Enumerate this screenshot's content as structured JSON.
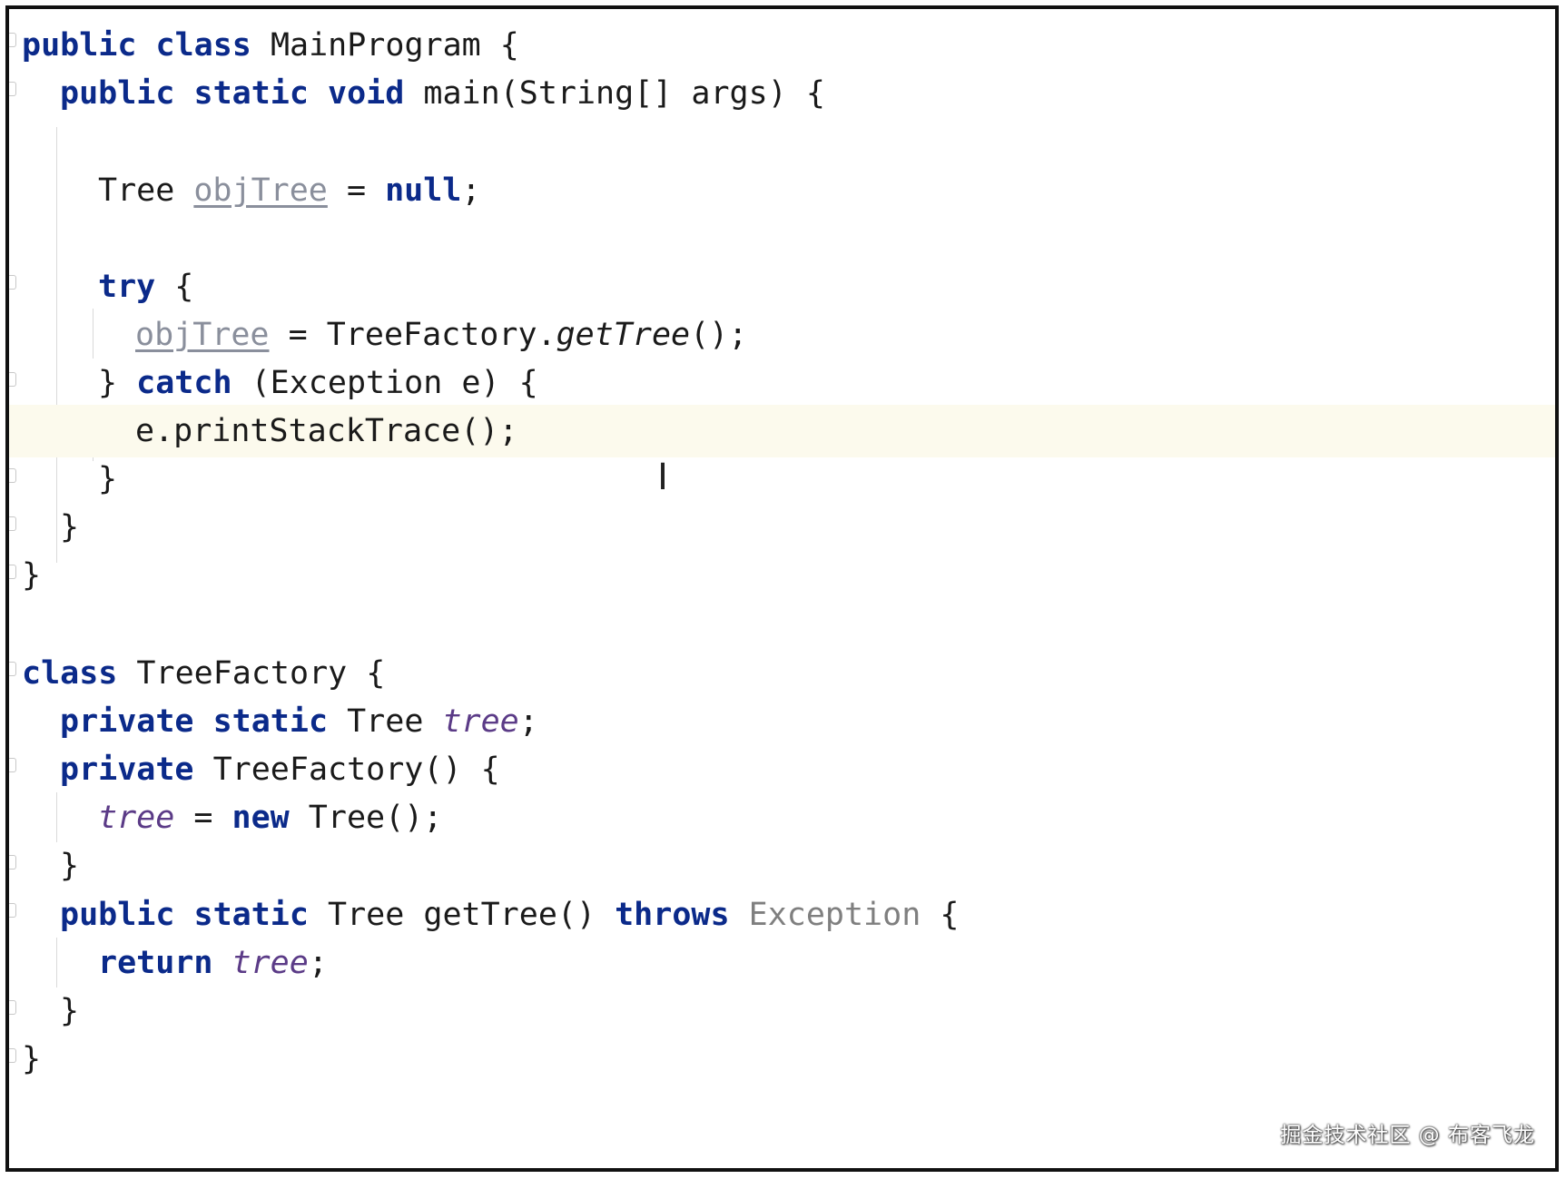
{
  "code": {
    "l1": {
      "kw1": "public",
      "kw2": "class",
      "rest": " MainProgram {"
    },
    "l2": {
      "kw1": "public",
      "kw2": "static",
      "kw3": "void",
      "rest": " main(String[] args) {"
    },
    "l3": {
      "type": "Tree ",
      "var": "objTree",
      "op": " = ",
      "kw": "null",
      "end": ";"
    },
    "l4": {
      "kw": "try",
      "rest": " {"
    },
    "l5": {
      "var": "objTree",
      "op": " = TreeFactory.",
      "method": "getTree",
      "end": "();"
    },
    "l6": {
      "open": "} ",
      "kw": "catch",
      "rest": " (Exception e) {"
    },
    "l7": {
      "text": "e.printStackTrace();"
    },
    "l8": {
      "text": "}"
    },
    "l9": {
      "text": "}"
    },
    "l10": {
      "text": "}"
    },
    "l11": {
      "kw": "class",
      "rest": " TreeFactory {"
    },
    "l12": {
      "kw1": "private",
      "kw2": "static",
      "type": " Tree ",
      "field": "tree",
      "end": ";"
    },
    "l13": {
      "kw": "private",
      "rest": " TreeFactory() {"
    },
    "l14": {
      "field": "tree",
      "op": " = ",
      "kw": "new",
      "rest": " Tree();"
    },
    "l15": {
      "text": "}"
    },
    "l16": {
      "kw1": "public",
      "kw2": "static",
      "rest": " Tree getTree() ",
      "kw3": "throws",
      "grey": " Exception",
      "end": " {"
    },
    "l17": {
      "kw": "return",
      "field": "tree",
      "end": ";"
    },
    "l18": {
      "text": "}"
    },
    "l19": {
      "text": "}"
    }
  },
  "cursor_icon": "text-cursor-ibeam",
  "cursor_glyph": "I",
  "watermark": "掘金技术社区 @ 布客飞龙"
}
